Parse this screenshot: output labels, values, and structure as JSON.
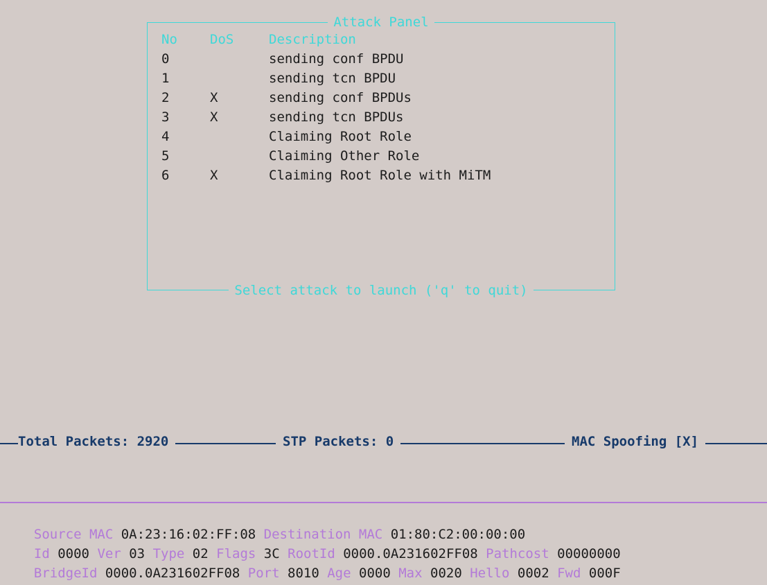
{
  "panel": {
    "title": "Attack Panel",
    "footer": "Select attack to launch ('q' to quit)",
    "headers": {
      "no": "No",
      "dos": "DoS",
      "desc": "Description"
    },
    "rows": [
      {
        "no": "0",
        "dos": "",
        "desc": "sending conf BPDU"
      },
      {
        "no": "1",
        "dos": "",
        "desc": "sending tcn BPDU"
      },
      {
        "no": "2",
        "dos": "X",
        "desc": "sending conf BPDUs"
      },
      {
        "no": "3",
        "dos": "X",
        "desc": "sending tcn BPDUs"
      },
      {
        "no": "4",
        "dos": "",
        "desc": "Claiming Root Role"
      },
      {
        "no": "5",
        "dos": "",
        "desc": "Claiming Other Role"
      },
      {
        "no": "6",
        "dos": "X",
        "desc": "Claiming Root Role with MiTM"
      }
    ]
  },
  "status": {
    "total": "Total Packets: 2920",
    "stp": "STP Packets: 0",
    "mac": "MAC Spoofing [X]"
  },
  "packet": {
    "line1": [
      {
        "k": "Source MAC",
        "v": "0A:23:16:02:FF:08"
      },
      {
        "k": "Destination MAC",
        "v": "01:80:C2:00:00:00"
      }
    ],
    "line2": [
      {
        "k": "Id",
        "v": "0000"
      },
      {
        "k": "Ver",
        "v": "03"
      },
      {
        "k": "Type",
        "v": "02"
      },
      {
        "k": "Flags",
        "v": "3C"
      },
      {
        "k": "RootId",
        "v": "0000.0A231602FF08"
      },
      {
        "k": "Pathcost",
        "v": "00000000"
      }
    ],
    "line3": [
      {
        "k": "BridgeId",
        "v": "0000.0A231602FF08"
      },
      {
        "k": "Port",
        "v": "8010"
      },
      {
        "k": "Age",
        "v": "0000"
      },
      {
        "k": "Max",
        "v": "0020"
      },
      {
        "k": "Hello",
        "v": "0002"
      },
      {
        "k": "Fwd",
        "v": "000F"
      }
    ]
  },
  "colors": {
    "accent": "#3fd8d8",
    "label": "#b37ad8",
    "status": "#173a6a",
    "background": "#d3cbc8"
  }
}
